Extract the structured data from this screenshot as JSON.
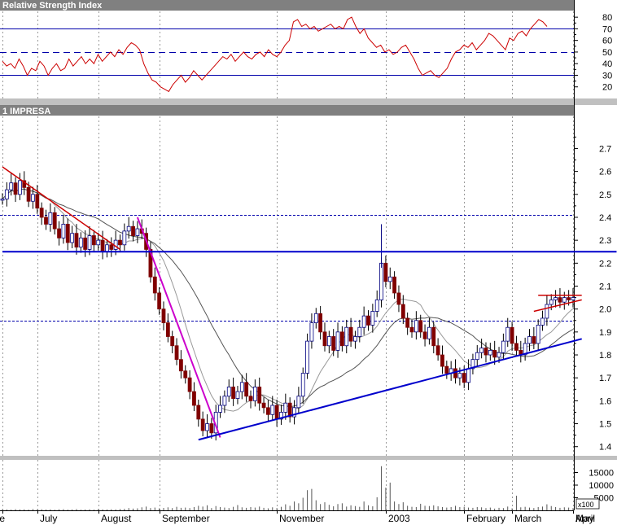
{
  "chart_data": [
    {
      "type": "line",
      "title": "Relative Strength Index",
      "ylim": [
        10,
        85
      ],
      "yticks": [
        20,
        30,
        40,
        50,
        60,
        70,
        80
      ],
      "reference_lines": [
        {
          "value": 70,
          "style": "solid"
        },
        {
          "value": 50,
          "style": "dashed"
        },
        {
          "value": 30,
          "style": "solid"
        }
      ],
      "series": [
        {
          "color": "#cc0000",
          "values": [
            42,
            38,
            40,
            36,
            44,
            38,
            30,
            36,
            34,
            42,
            38,
            30,
            36,
            40,
            34,
            36,
            44,
            38,
            42,
            46,
            40,
            44,
            40,
            48,
            42,
            46,
            50,
            46,
            52,
            48,
            54,
            58,
            56,
            52,
            40,
            32,
            26,
            24,
            20,
            18,
            16,
            22,
            26,
            30,
            24,
            28,
            34,
            30,
            26,
            30,
            34,
            38,
            42,
            46,
            44,
            48,
            42,
            46,
            50,
            46,
            44,
            48,
            50,
            46,
            52,
            48,
            46,
            50,
            56,
            60,
            76,
            78,
            72,
            74,
            70,
            72,
            68,
            70,
            72,
            74,
            70,
            72,
            70,
            78,
            80,
            72,
            66,
            70,
            62,
            58,
            54,
            56,
            50,
            52,
            48,
            50,
            54,
            56,
            50,
            44,
            36,
            30,
            32,
            34,
            30,
            28,
            32,
            36,
            44,
            50,
            52,
            56,
            54,
            58,
            52,
            56,
            60,
            66,
            64,
            60,
            56,
            52,
            62,
            60,
            66,
            68,
            64,
            70,
            74,
            78,
            76,
            72
          ]
        }
      ]
    },
    {
      "type": "candlestick",
      "title": "1 IMPRESA",
      "ylim": [
        1.36,
        2.84
      ],
      "yticks": [
        1.4,
        1.5,
        1.6,
        1.7,
        1.8,
        1.9,
        2.0,
        2.1,
        2.2,
        2.3,
        2.4,
        2.5,
        2.6,
        2.7
      ],
      "xticks": [
        "June",
        "July",
        "August",
        "September",
        "November",
        "2003",
        "February",
        "March",
        "April",
        "May"
      ],
      "close": [
        2.48,
        2.52,
        2.55,
        2.5,
        2.56,
        2.53,
        2.47,
        2.5,
        2.44,
        2.4,
        2.37,
        2.42,
        2.35,
        2.31,
        2.37,
        2.29,
        2.33,
        2.27,
        2.31,
        2.26,
        2.32,
        2.28,
        2.3,
        2.25,
        2.28,
        2.26,
        2.3,
        2.28,
        2.34,
        2.36,
        2.32,
        2.35,
        2.33,
        2.26,
        2.14,
        2.07,
        2.0,
        1.94,
        1.88,
        1.84,
        1.78,
        1.73,
        1.7,
        1.64,
        1.58,
        1.52,
        1.47,
        1.5,
        1.46,
        1.55,
        1.58,
        1.62,
        1.66,
        1.61,
        1.64,
        1.68,
        1.62,
        1.6,
        1.66,
        1.59,
        1.57,
        1.54,
        1.58,
        1.52,
        1.55,
        1.59,
        1.53,
        1.57,
        1.62,
        1.72,
        1.86,
        1.94,
        1.98,
        1.9,
        1.84,
        1.88,
        1.82,
        1.9,
        1.84,
        1.92,
        1.86,
        1.88,
        1.92,
        1.97,
        1.93,
        1.99,
        2.04,
        2.2,
        2.12,
        2.14,
        2.07,
        2.02,
        1.96,
        1.92,
        1.9,
        1.95,
        1.9,
        1.87,
        1.92,
        1.84,
        1.8,
        1.75,
        1.72,
        1.74,
        1.7,
        1.72,
        1.68,
        1.74,
        1.78,
        1.81,
        1.83,
        1.8,
        1.82,
        1.79,
        1.81,
        1.86,
        1.92,
        1.85,
        1.82,
        1.8,
        1.85,
        1.88,
        1.85,
        1.93,
        1.96,
        2.02,
        2.04,
        2.05,
        2.03,
        2.05,
        2.04,
        2.05
      ],
      "trendlines": [
        {
          "color": "#cc0000",
          "from": [
            0,
            2.62
          ],
          "to": [
            27,
            2.26
          ]
        },
        {
          "color": "#cc00cc",
          "from": [
            31,
            2.4
          ],
          "to": [
            50,
            1.44
          ]
        },
        {
          "color": "#0000cc",
          "from": [
            45,
            1.43
          ],
          "to": [
            133,
            1.87
          ]
        },
        {
          "color": "#0000cc",
          "from": [
            0,
            2.25
          ],
          "to": [
            141,
            2.25
          ]
        },
        {
          "color": "#cc0000",
          "from": [
            123,
            2.06
          ],
          "to": [
            133,
            2.06
          ]
        },
        {
          "color": "#cc0000",
          "from": [
            122,
            1.99
          ],
          "to": [
            133,
            2.04
          ]
        }
      ],
      "dotted_levels": [
        2.41,
        1.95
      ]
    },
    {
      "type": "bar",
      "title": "",
      "ylim": [
        0,
        20000
      ],
      "yticks": [
        5000,
        10000,
        15000
      ],
      "axis_note": "x100",
      "values": [
        420,
        380,
        300,
        450,
        350,
        400,
        300,
        500,
        350,
        420,
        300,
        380,
        250,
        400,
        450,
        300,
        350,
        500,
        280,
        350,
        400,
        300,
        450,
        380,
        350,
        420,
        380,
        500,
        600,
        900,
        700,
        800,
        1200,
        1500,
        900,
        1100,
        800,
        950,
        1200,
        900,
        1400,
        1000,
        1100,
        900,
        1300,
        1800,
        1500,
        2000,
        900,
        1700,
        1300,
        1100,
        900,
        1400,
        2100,
        1200,
        1000,
        1300,
        1100,
        1500,
        1000,
        800,
        1200,
        900,
        1400,
        2400,
        1800,
        3500,
        2800,
        5000,
        8000,
        8500,
        4000,
        2500,
        3200,
        2200,
        1600,
        2500,
        2800,
        1500,
        2000,
        1700,
        1400,
        3500,
        2000,
        1600,
        5200,
        17500,
        9000,
        11000,
        3500,
        2500,
        3200,
        1800,
        1400,
        1300,
        2600,
        1800,
        1700,
        2000,
        1600,
        1300,
        1100,
        1300,
        1800,
        1300,
        1400,
        1100,
        1000,
        1300,
        1200,
        900,
        1100,
        700,
        1000,
        900,
        1500,
        800,
        5800,
        1200,
        1400,
        1100,
        900,
        1300,
        1500,
        2400,
        1700,
        1300,
        1000,
        1200,
        1100,
        900,
        700,
        500,
        600,
        400
      ]
    }
  ]
}
